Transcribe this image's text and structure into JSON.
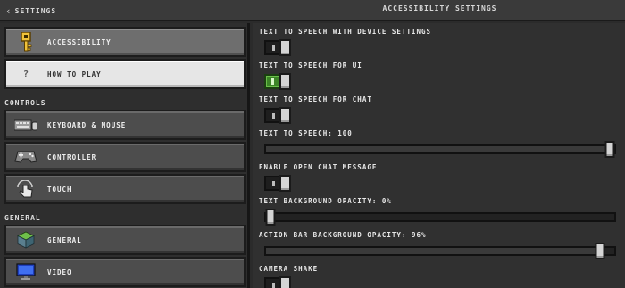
{
  "header": {
    "back_label": "Settings",
    "title": "Accessibility Settings"
  },
  "sidebar": {
    "top_items": [
      {
        "label": "Accessibility",
        "icon": "key-icon",
        "selected": true
      },
      {
        "label": "How to Play",
        "icon": "question-mark-icon",
        "icon_glyph": "?"
      }
    ],
    "controls_label": "Controls",
    "controls_items": [
      {
        "label": "Keyboard & Mouse",
        "icon": "keyboard-mouse-icon"
      },
      {
        "label": "Controller",
        "icon": "controller-icon"
      },
      {
        "label": "Touch",
        "icon": "touch-hand-icon"
      }
    ],
    "general_label": "General",
    "general_items": [
      {
        "label": "General",
        "icon": "grass-block-icon"
      },
      {
        "label": "Video",
        "icon": "monitor-icon"
      }
    ]
  },
  "settings": [
    {
      "label": "Text To Speech with Device Settings",
      "type": "toggle",
      "on": false
    },
    {
      "label": "Text To Speech For UI",
      "type": "toggle",
      "on": true
    },
    {
      "label": "Text To Speech For Chat",
      "type": "toggle",
      "on": false
    },
    {
      "label": "Text to Speech: 100",
      "type": "slider",
      "value": 1.0
    },
    {
      "label": "Enable Open Chat Message",
      "type": "toggle",
      "on": false
    },
    {
      "label": "Text Background Opacity: 0%",
      "type": "slider",
      "value": 0.0
    },
    {
      "label": "Action Bar Background Opacity: 96%",
      "type": "slider",
      "value": 0.96
    },
    {
      "label": "Camera Shake",
      "type": "toggle",
      "on": false
    }
  ],
  "colors": {
    "toggle_on": "#3c8527",
    "panel": "#303030",
    "button": "#4d4d4d"
  }
}
